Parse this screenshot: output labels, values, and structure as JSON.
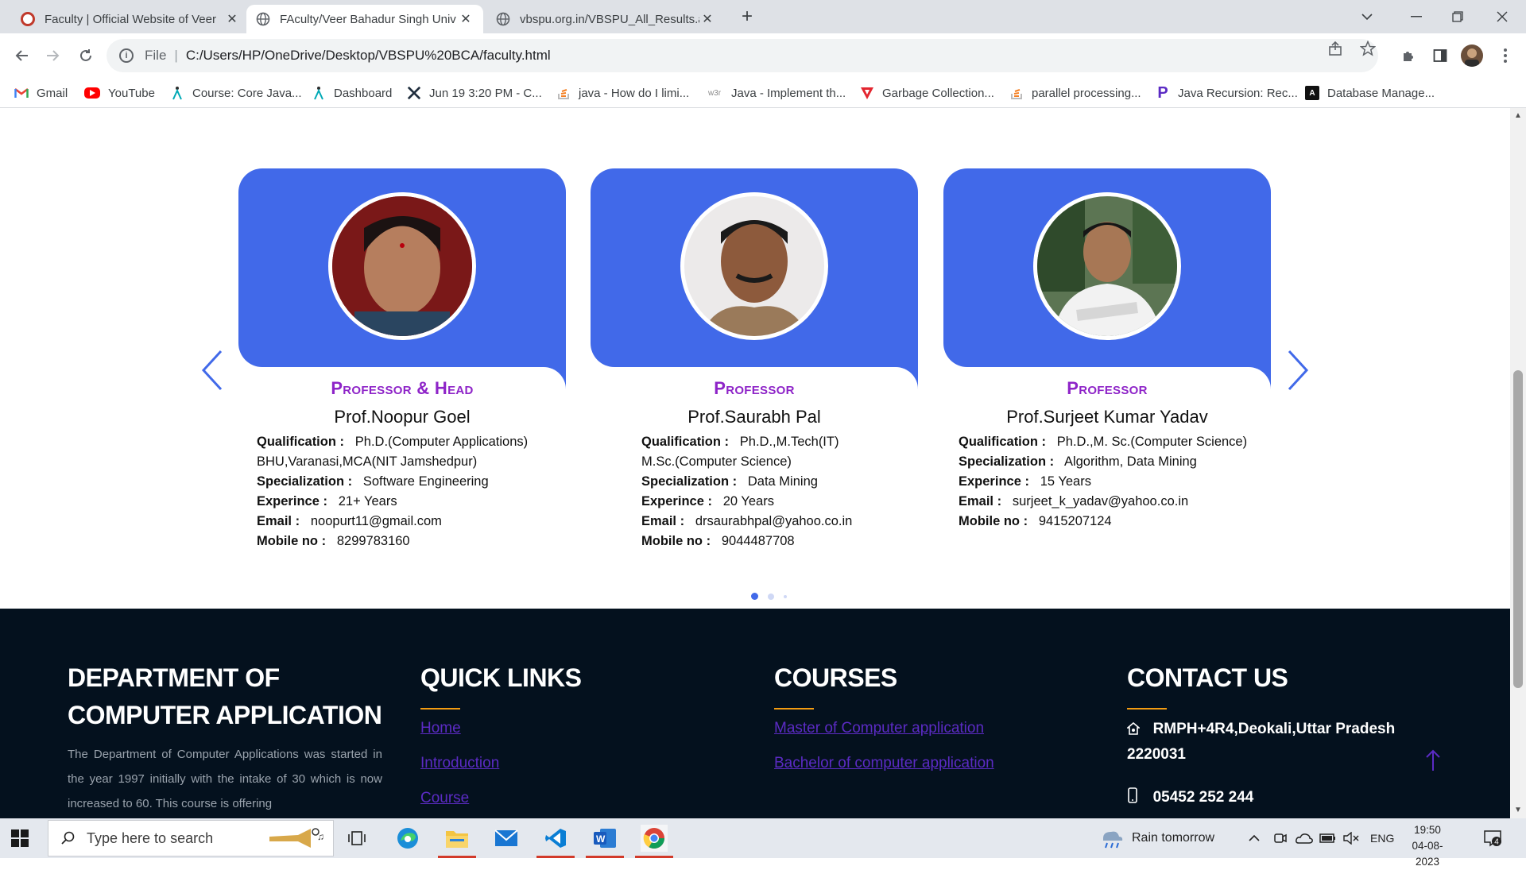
{
  "browser": {
    "tabs": [
      {
        "title": "Faculty | Official Website of Veer",
        "active": false
      },
      {
        "title": "FAculty/Veer Bahadur Singh Univ",
        "active": true
      },
      {
        "title": "vbspu.org.in/VBSPU_All_Results.a",
        "active": false
      }
    ],
    "new_tab": "+",
    "address": {
      "scheme_label": "File",
      "separator": "|",
      "url": "C:/Users/HP/OneDrive/Desktop/VBSPU%20BCA/faculty.html"
    },
    "bookmarks": [
      {
        "label": "Gmail",
        "icon": "gmail-icon"
      },
      {
        "label": "YouTube",
        "icon": "youtube-icon"
      },
      {
        "label": "Course: Core Java...",
        "icon": "course-icon"
      },
      {
        "label": "Dashboard",
        "icon": "dashboard-icon"
      },
      {
        "label": "Jun 19 3:20 PM - C...",
        "icon": "cross-icon"
      },
      {
        "label": "java - How do I limi...",
        "icon": "stackoverflow-icon"
      },
      {
        "label": "Java - Implement th...",
        "icon": "w3r-icon"
      },
      {
        "label": "Garbage Collection...",
        "icon": "triangle-icon"
      },
      {
        "label": "parallel processing...",
        "icon": "stackoverflow-icon"
      },
      {
        "label": "Java Recursion: Rec...",
        "icon": "p-icon"
      },
      {
        "label": "Database Manage...",
        "icon": "db-icon"
      }
    ],
    "w3r_text": "w3r"
  },
  "faculty": [
    {
      "role": "Professor & Head",
      "name": "Prof.Noopur Goel",
      "lines": [
        {
          "k": "Qualification :",
          "v": "Ph.D.(Computer Applications)"
        },
        {
          "k": "",
          "v": "BHU,Varanasi,MCA(NIT Jamshedpur)"
        },
        {
          "k": "Specialization :",
          "v": "Software Engineering"
        },
        {
          "k": "Experince :",
          "v": "21+ Years"
        },
        {
          "k": "Email :",
          "v": "noopurt11@gmail.com"
        },
        {
          "k": "Mobile no :",
          "v": "8299783160"
        }
      ],
      "photo_bg": "#8a1e1e"
    },
    {
      "role": "Professor",
      "name": "Prof.Saurabh Pal",
      "lines": [
        {
          "k": "Qualification :",
          "v": "Ph.D.,M.Tech(IT)"
        },
        {
          "k": "",
          "v": "M.Sc.(Computer Science)"
        },
        {
          "k": "Specialization :",
          "v": "Data Mining"
        },
        {
          "k": "Experince :",
          "v": "20 Years"
        },
        {
          "k": "Email :",
          "v": "drsaurabhpal@yahoo.co.in"
        },
        {
          "k": "Mobile no :",
          "v": "9044487708"
        }
      ],
      "photo_bg": "#e8e6e6"
    },
    {
      "role": "Professor",
      "name": "Prof.Surjeet Kumar Yadav",
      "lines": [
        {
          "k": "Qualification :",
          "v": "Ph.D.,M. Sc.(Computer Science)"
        },
        {
          "k": "Specialization :",
          "v": "Algorithm, Data Mining"
        },
        {
          "k": "Experince :",
          "v": "15 Years"
        },
        {
          "k": "Email :",
          "v": "surjeet_k_yadav@yahoo.co.in"
        },
        {
          "k": "Mobile no :",
          "v": "9415207124"
        }
      ],
      "photo_bg": "#4f6a4a"
    }
  ],
  "footer": {
    "dept": {
      "heading_line1": "DEPARTMENT OF",
      "heading_line2": "COMPUTER APPLICATION",
      "desc": "The Department of Computer Applications was started in the year 1997 initially with the intake of 30 which is now increased to 60. This course is offering"
    },
    "quick_links": {
      "heading": "QUICK LINKS",
      "links": [
        "Home",
        "Introduction",
        "Course"
      ]
    },
    "courses": {
      "heading": "COURSES",
      "links": [
        "Master of Computer application",
        "Bachelor of computer application"
      ]
    },
    "contact": {
      "heading": "CONTACT US",
      "address": "RMPH+4R4,Deokali,Uttar Pradesh 2220031",
      "phone": "05452 252 244"
    }
  },
  "taskbar": {
    "search_placeholder": "Type here to search",
    "weather": "Rain tomorrow",
    "lang": "ENG",
    "time": "19:50",
    "date": "04-08-2023",
    "notifications": "4"
  },
  "colors": {
    "card_blue": "#4169e9",
    "role_purple": "#8e24c8",
    "footer_bg": "#04111e",
    "accent_orange": "#f39c12",
    "link_purple": "#5b2bc4"
  }
}
